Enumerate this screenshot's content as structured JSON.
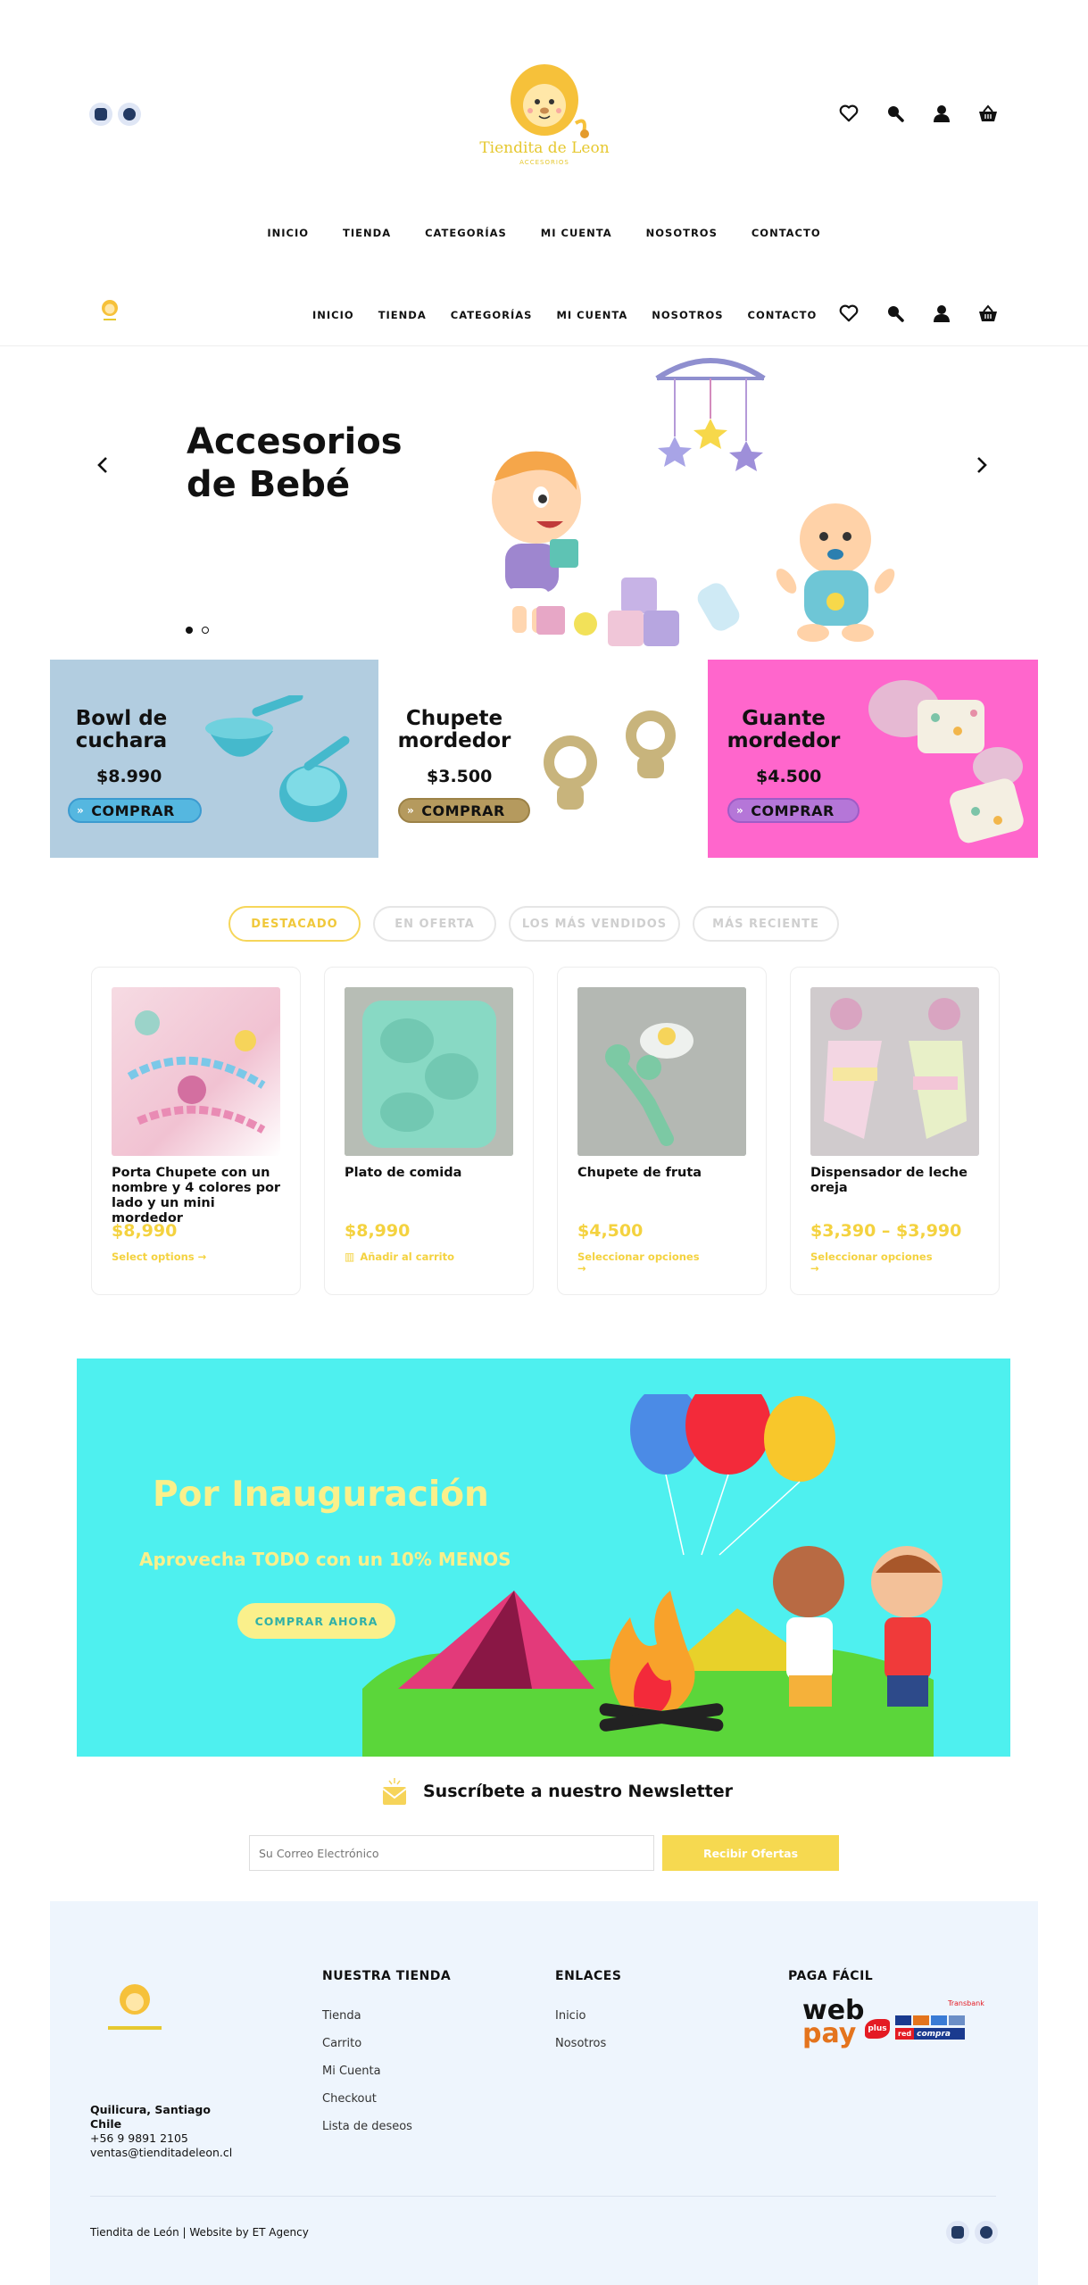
{
  "header": {
    "logo_text": "Tiendita de Leon",
    "logo_sub": "ACCESORIOS",
    "nav": [
      "INICIO",
      "TIENDA",
      "CATEGORÍAS",
      "MI CUENTA",
      "NOSOTROS",
      "CONTACTO"
    ]
  },
  "sticky_nav": [
    "INICIO",
    "TIENDA",
    "CATEGORÍAS",
    "MI CUENTA",
    "NOSOTROS",
    "CONTACTO"
  ],
  "hero": {
    "title_line1": "Accesorios",
    "title_line2": "de Bebé",
    "slides": 2,
    "active_slide": 1
  },
  "promos": [
    {
      "title_line1": "Bowl de",
      "title_line2": "cuchara",
      "price": "$8.990",
      "button": "COMPRAR",
      "bg": "#b2cde0",
      "btn_color": "#55b7e0"
    },
    {
      "title_line1": "Chupete",
      "title_line2": "mordedor",
      "price": "$3.500",
      "button": "COMPRAR",
      "bg": "#ffffff",
      "btn_color": "#b59a5e"
    },
    {
      "title_line1": "Guante",
      "title_line2": "mordedor",
      "price": "$4.500",
      "button": "COMPRAR",
      "bg": "#ff66cc",
      "btn_color": "#b576d8"
    }
  ],
  "tabs": [
    "DESTACADO",
    "EN OFERTA",
    "LOS MÁS VENDIDOS",
    "MÁS RECIENTE"
  ],
  "products": [
    {
      "name": "Porta Chupete con un nombre y 4 colores por lado y un mini mordedor",
      "price": "$8,990",
      "action": "Select options →"
    },
    {
      "name": "Plato de comida",
      "price": "$8,990",
      "action": "Añadir al carrito"
    },
    {
      "name": "Chupete de fruta",
      "price": "$4,500",
      "action": "Seleccionar opciones →"
    },
    {
      "name": "Dispensador de leche oreja",
      "price": "$3,390 – $3,990",
      "action": "Seleccionar opciones →"
    }
  ],
  "banner": {
    "title": "Por Inauguración",
    "subtitle": "Aprovecha TODO con un 10% MENOS",
    "button": "COMPRAR AHORA"
  },
  "newsletter": {
    "title": "Suscríbete a nuestro Newsletter",
    "placeholder": "Su Correo Electrónico",
    "button": "Recibir Ofertas"
  },
  "footer": {
    "address_line1": "Quilicura, Santiago",
    "address_line2": "Chile",
    "phone": "+56 9 9891 2105",
    "email": "ventas@tienditadeleon.cl",
    "col1_title": "NUESTRA TIENDA",
    "col1_links": [
      "Tienda",
      "Carrito",
      "Mi Cuenta",
      "Checkout",
      "Lista de deseos"
    ],
    "col2_title": "ENLACES",
    "col2_links": [
      "Inicio",
      "Nosotros"
    ],
    "col3_title": "PAGA FÁCIL",
    "webpay_text1": "web",
    "webpay_text2": "pay",
    "webpay_plus": "plus",
    "transbank": "Transbank",
    "redcompra": "compra",
    "copyright": "Tiendita de León | Website by ET Agency"
  }
}
